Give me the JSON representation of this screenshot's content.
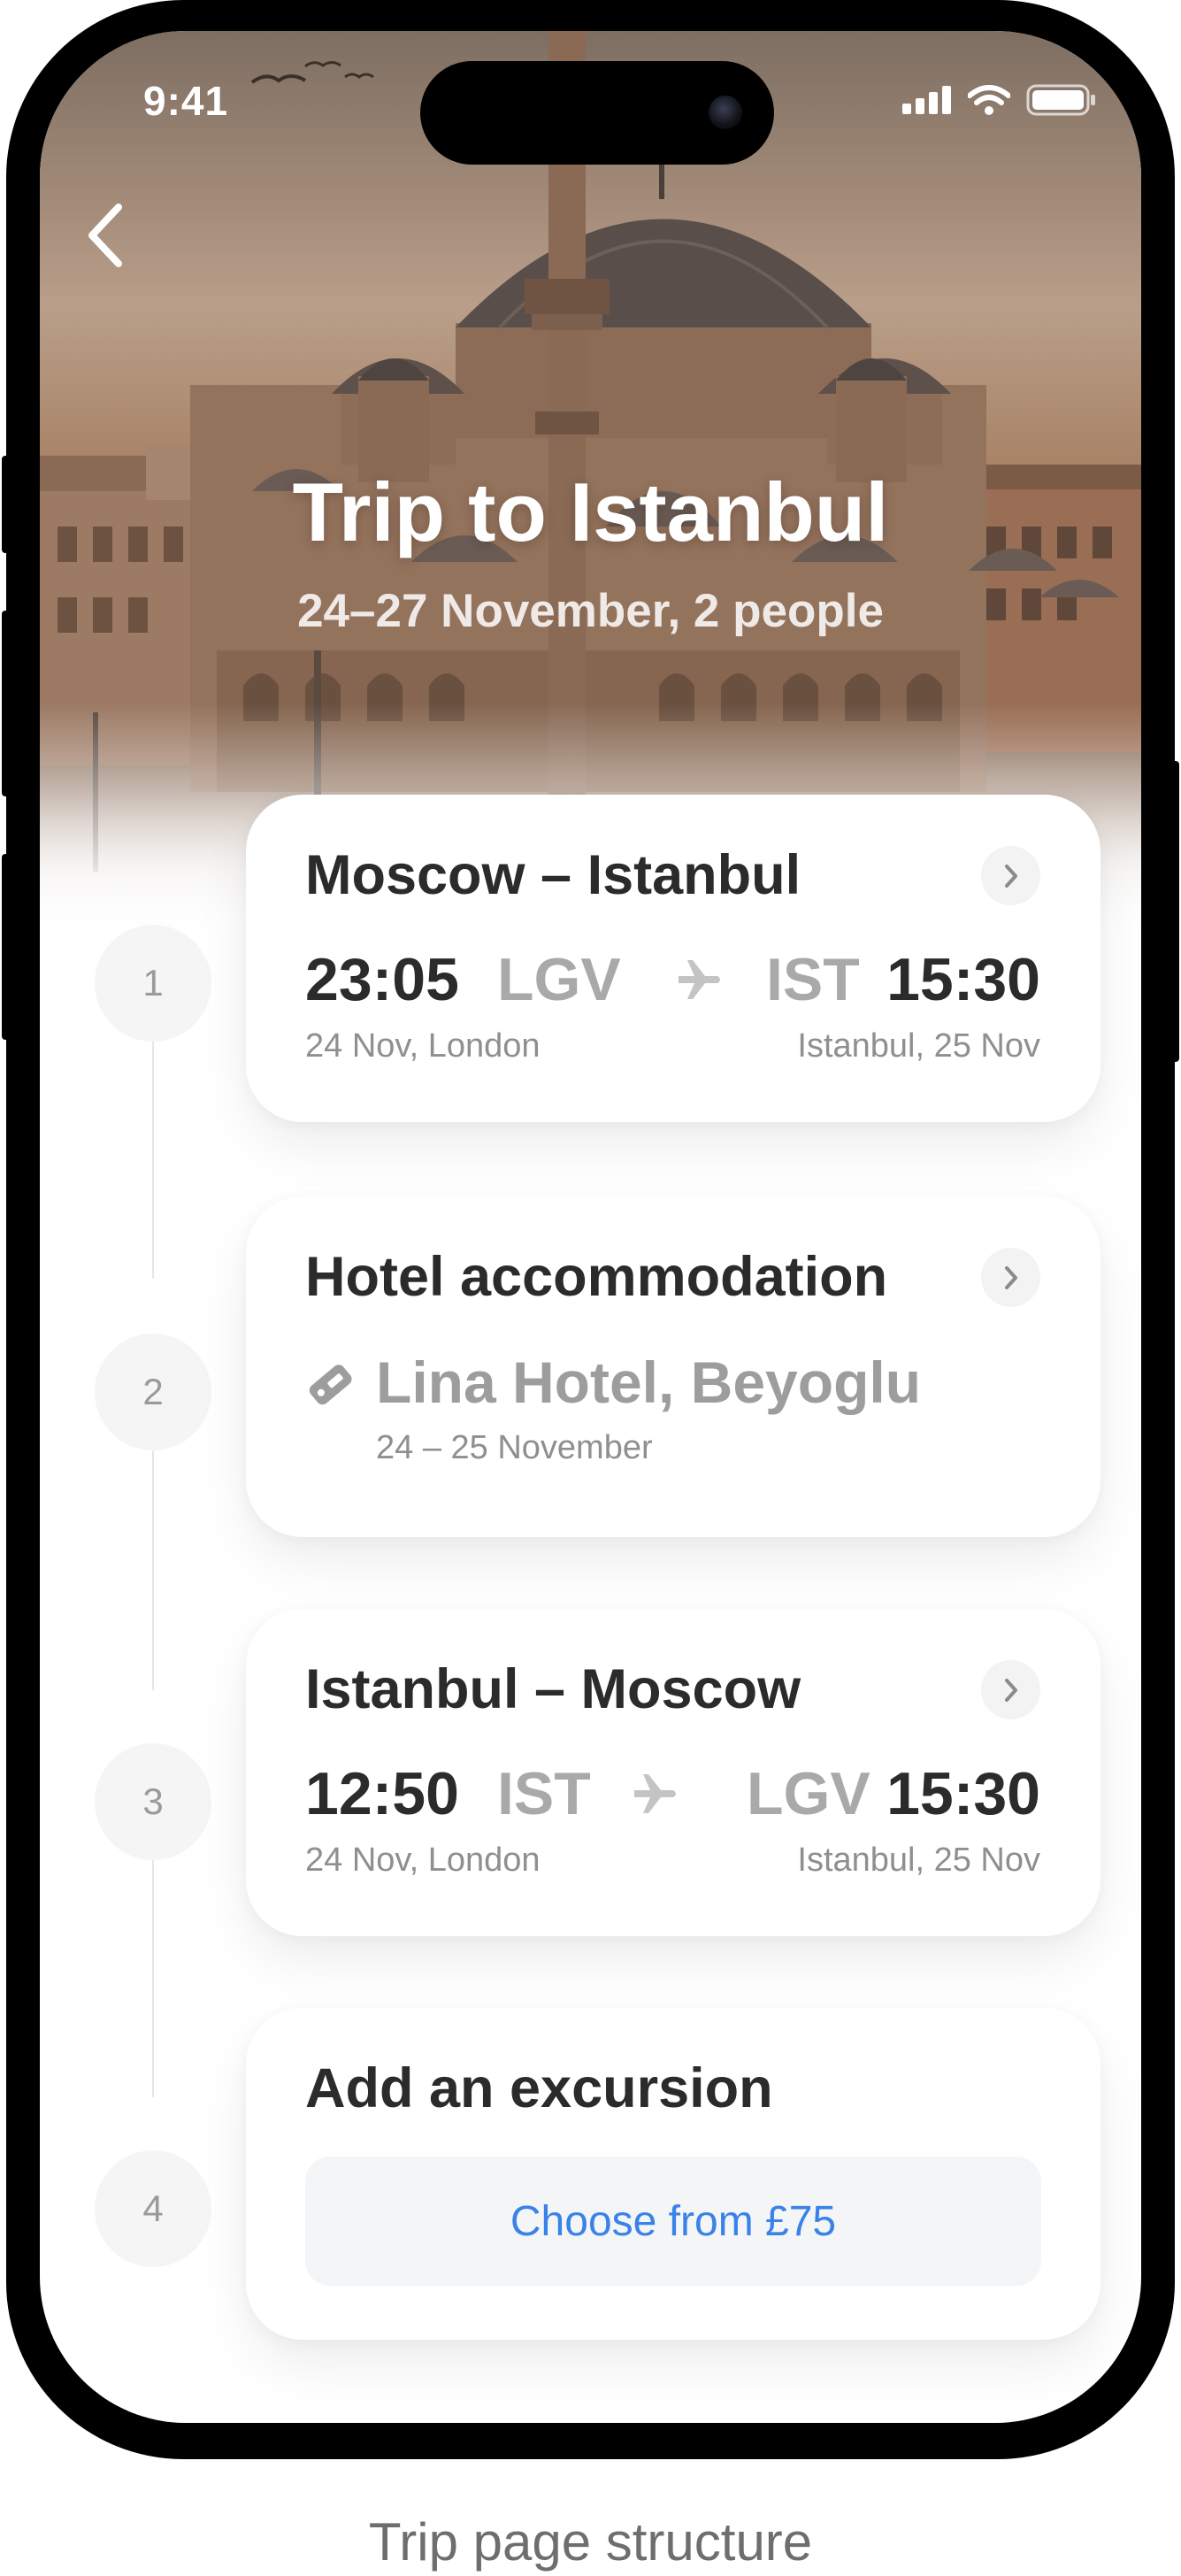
{
  "status_bar": {
    "time": "9:41"
  },
  "header": {
    "title": "Trip to Istanbul",
    "subtitle": "24–27 November, 2 people"
  },
  "steps": [
    {
      "number": "1"
    },
    {
      "number": "2"
    },
    {
      "number": "3"
    },
    {
      "number": "4"
    }
  ],
  "flight_out": {
    "title": "Moscow – Istanbul",
    "depart_time": "23:05",
    "depart_code": "LGV",
    "arrive_code": "IST",
    "arrive_time": "15:30",
    "depart_info": "24 Nov, London",
    "arrive_info": "Istanbul, 25 Nov"
  },
  "hotel": {
    "title": "Hotel accommodation",
    "name": "Lina Hotel, Beyoglu",
    "dates": "24 – 25 November"
  },
  "flight_back": {
    "title": "Istanbul – Moscow",
    "depart_time": "12:50",
    "depart_code": "IST",
    "arrive_code": "LGV",
    "arrive_time": "15:30",
    "depart_info": "24 Nov, London",
    "arrive_info": "Istanbul, 25 Nov"
  },
  "excursion": {
    "title": "Add an excursion",
    "button_label": "Choose from £75"
  },
  "caption": "Trip page structure",
  "icons": {
    "back": "chevron-left-icon",
    "chevron": "chevron-right-icon",
    "plane": "airplane-icon",
    "tag": "tag-icon",
    "signal": "cellular-signal-icon",
    "wifi": "wifi-icon",
    "battery": "battery-icon"
  },
  "colors": {
    "accent": "#3a82ea",
    "text": "#2b2b2b",
    "muted": "#a9a9a9"
  }
}
